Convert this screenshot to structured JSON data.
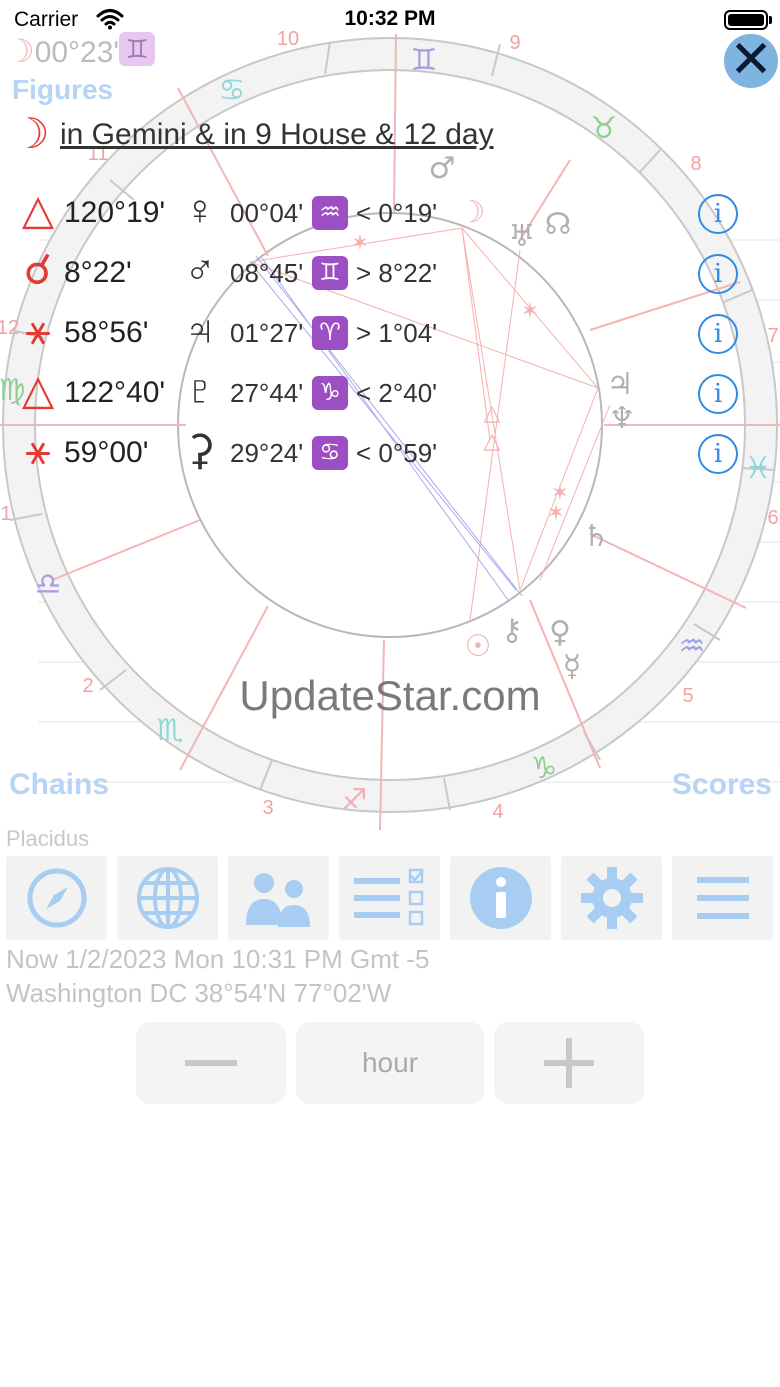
{
  "status_bar": {
    "carrier": "Carrier",
    "time": "10:32 PM"
  },
  "header": {
    "moon_position": "00°23'",
    "moon_sign": "♊",
    "section_title": "Figures",
    "figure_title": "in Gemini & in 9 House & 12 day"
  },
  "wheel": {
    "house_numbers": [
      "10",
      "9",
      "8",
      "7",
      "6",
      "5",
      "4",
      "3",
      "2",
      "1",
      "12",
      "11"
    ],
    "sign_glyphs": [
      "♊",
      "♉",
      "♓",
      "♒",
      "♑",
      "♐",
      "♏",
      "♎",
      "♍",
      "♋"
    ],
    "planet_glyphs": [
      "♂",
      "☽",
      "♅",
      "☊",
      "♃",
      "♆",
      "♄",
      "♀",
      "☿",
      "☉",
      "⚷"
    ]
  },
  "aspects": [
    {
      "symbol": "△",
      "angle": "120°19'",
      "planet": "♀",
      "position": "00°04'",
      "sign": "♒",
      "orb": "< 0°19'"
    },
    {
      "symbol": "☌",
      "angle": "8°22'",
      "planet": "♂",
      "position": "08°45'",
      "sign": "♊",
      "orb": "> 8°22'"
    },
    {
      "symbol": "⚹",
      "angle": "58°56'",
      "planet": "♃",
      "position": "01°27'",
      "sign": "♈",
      "orb": "> 1°04'"
    },
    {
      "symbol": "△",
      "angle": "122°40'",
      "planet": "♇",
      "position": "27°44'",
      "sign": "♑",
      "orb": "< 2°40'"
    },
    {
      "symbol": "⚹",
      "angle": "59°00'",
      "planet": "⚳",
      "position": "29°24'",
      "sign": "♋",
      "orb": "< 0°59'"
    }
  ],
  "watermark": "UpdateStar.com",
  "sections": {
    "chains": "Chains",
    "scores": "Scores",
    "house_system": "Placidus"
  },
  "toolbar_icons": [
    "compass-icon",
    "globe-icon",
    "people-icon",
    "checklist-icon",
    "info-icon",
    "gear-icon",
    "menu-icon"
  ],
  "footer": {
    "date": "Now 1/2/2023 Mon 10:31 PM Gmt -5",
    "place": "Washington DC 38°54'N 77°02'W"
  },
  "stepper": {
    "minus": "−",
    "unit": "hour",
    "plus": "+"
  },
  "colors": {
    "accent": "#2f8be8",
    "aspect_red": "#e53935",
    "light_blue": "#b6d4f4",
    "sign_purple": "#9c4fc2"
  }
}
